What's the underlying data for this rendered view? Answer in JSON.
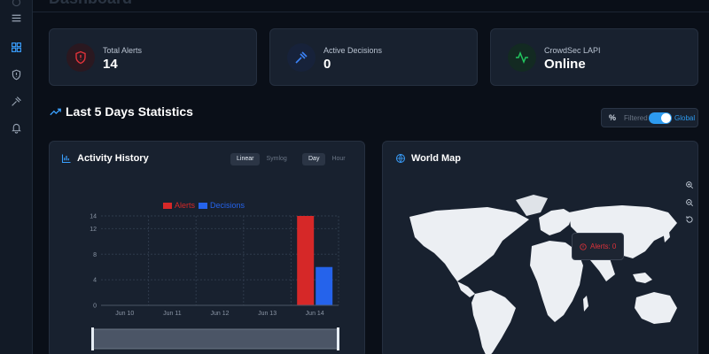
{
  "header": {
    "title": "Dashboard"
  },
  "sidebar": {
    "items": [
      {
        "icon": "menu-icon"
      },
      {
        "icon": "grid-icon",
        "active": true
      },
      {
        "icon": "shield-icon"
      },
      {
        "icon": "gavel-icon"
      },
      {
        "icon": "bell-icon"
      }
    ]
  },
  "stats": [
    {
      "label": "Total Alerts",
      "value": "14",
      "icon": "alert-shield-icon",
      "color": "#e0323a"
    },
    {
      "label": "Active Decisions",
      "value": "0",
      "icon": "gavel-icon",
      "color": "#3b82f6"
    },
    {
      "label": "CrowdSec LAPI",
      "value": "Online",
      "icon": "activity-icon",
      "color": "#22c55e"
    }
  ],
  "section": {
    "title": "Last 5 Days Statistics"
  },
  "filter_toggle": {
    "symbol": "%",
    "left_label": "Filtered",
    "right_label": "Global",
    "state": "Global"
  },
  "activity": {
    "title": "Activity History",
    "scale_options": [
      "Linear",
      "Symlog"
    ],
    "scale_selected": "Linear",
    "granularity_options": [
      "Day",
      "Hour"
    ],
    "granularity_selected": "Day"
  },
  "chart_data": {
    "type": "bar",
    "categories": [
      "Jun 10",
      "Jun 11",
      "Jun 12",
      "Jun 13",
      "Jun 14"
    ],
    "series": [
      {
        "name": "Alerts",
        "values": [
          0,
          0,
          0,
          0,
          14
        ],
        "color": "#d62828"
      },
      {
        "name": "Decisions",
        "values": [
          0,
          0,
          0,
          0,
          6
        ],
        "color": "#2563eb"
      }
    ],
    "yticks": [
      0,
      4,
      8,
      12,
      14
    ],
    "ylim": [
      0,
      14
    ],
    "grid": true,
    "legend": "top-center"
  },
  "world_map": {
    "title": "World Map",
    "tooltip": "Alerts: 0",
    "controls": [
      "zoom-in-icon",
      "zoom-out-icon",
      "reset-icon"
    ]
  }
}
